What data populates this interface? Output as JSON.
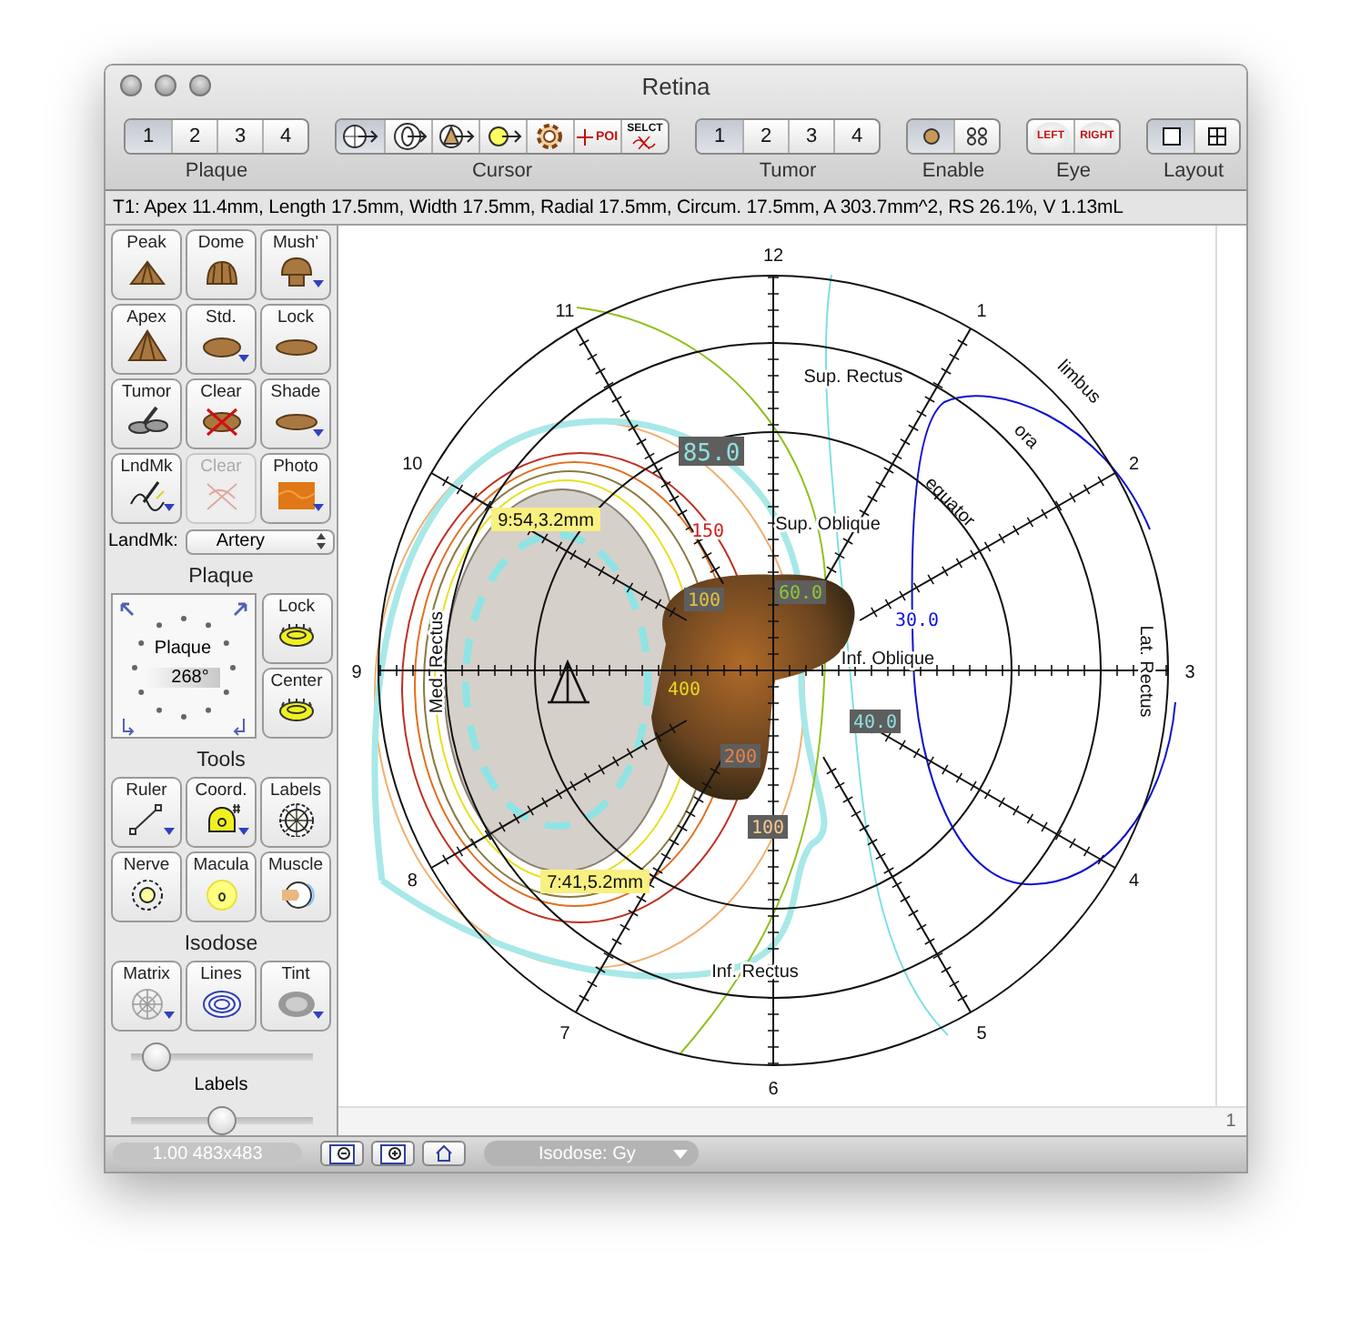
{
  "window": {
    "title": "Retina"
  },
  "toolbar": [
    {
      "label": "Plaque",
      "kind": "numbers",
      "buttons": [
        {
          "text": "1",
          "selected": true
        },
        {
          "text": "2",
          "selected": false
        },
        {
          "text": "3",
          "selected": false
        },
        {
          "text": "4",
          "selected": false
        }
      ]
    },
    {
      "label": "Cursor",
      "kind": "cursor",
      "buttons": [
        {
          "selected": true
        },
        {
          "selected": false
        },
        {
          "selected": false
        },
        {
          "selected": false
        },
        {
          "selected": false
        },
        {
          "text": "POI",
          "selected": false
        },
        {
          "text": "SELCT",
          "selected": false
        }
      ]
    },
    {
      "label": "Tumor",
      "kind": "numbers",
      "buttons": [
        {
          "text": "1",
          "selected": true
        },
        {
          "text": "2",
          "selected": false
        },
        {
          "text": "3",
          "selected": false
        },
        {
          "text": "4",
          "selected": false
        }
      ]
    },
    {
      "label": "Enable",
      "kind": "enable",
      "buttons": [
        {
          "selected": true
        },
        {
          "selected": false
        }
      ]
    },
    {
      "label": "Eye",
      "kind": "eye",
      "buttons": [
        {
          "text": "LEFT",
          "selected": false
        },
        {
          "text": "RIGHT",
          "selected": false
        }
      ]
    },
    {
      "label": "Layout",
      "kind": "layout",
      "buttons": [
        {
          "selected": true
        },
        {
          "selected": false
        }
      ]
    }
  ],
  "info_bar": "T1: Apex 11.4mm, Length 17.5mm, Width 17.5mm, Radial 17.5mm, Circum. 17.5mm, A 303.7mm^2, RS 26.1%, V 1.13mL",
  "sidebar": {
    "shape_tools": [
      {
        "label": "Peak",
        "caret": false,
        "disabled": false
      },
      {
        "label": "Dome",
        "caret": false,
        "disabled": false
      },
      {
        "label": "Mush'",
        "caret": true,
        "disabled": false
      },
      {
        "label": "Apex",
        "caret": false,
        "disabled": false
      },
      {
        "label": "Std.",
        "caret": true,
        "disabled": false
      },
      {
        "label": "Lock",
        "caret": false,
        "disabled": false
      },
      {
        "label": "Tumor",
        "caret": false,
        "disabled": false
      },
      {
        "label": "Clear",
        "caret": false,
        "disabled": false
      },
      {
        "label": "Shade",
        "caret": true,
        "disabled": false
      },
      {
        "label": "LndMk",
        "caret": true,
        "disabled": false
      },
      {
        "label": "Clear",
        "caret": false,
        "disabled": true
      },
      {
        "label": "Photo",
        "caret": true,
        "disabled": false
      }
    ],
    "landmark": {
      "label": "LandMk:",
      "value": "Artery"
    },
    "plaque": {
      "title": "Plaque",
      "dial_label": "Plaque",
      "angle": "268°",
      "buttons": [
        {
          "label": "Lock"
        },
        {
          "label": "Center"
        }
      ]
    },
    "tools": {
      "title": "Tools",
      "buttons": [
        {
          "label": "Ruler",
          "caret": true
        },
        {
          "label": "Coord.",
          "caret": true
        },
        {
          "label": "Labels",
          "caret": false
        },
        {
          "label": "Nerve",
          "caret": false
        },
        {
          "label": "Macula",
          "caret": false
        },
        {
          "label": "Muscle",
          "caret": false
        }
      ]
    },
    "isodose": {
      "title": "Isodose",
      "buttons": [
        {
          "label": "Matrix",
          "caret": true
        },
        {
          "label": "Lines",
          "caret": false
        },
        {
          "label": "Tint",
          "caret": true
        }
      ],
      "slider": {
        "level": 0.08
      },
      "labels_slider": {
        "label": "Labels",
        "level": 0.5
      }
    }
  },
  "diagram": {
    "clock_labels": [
      "12",
      "1",
      "2",
      "3",
      "4",
      "5",
      "6",
      "7",
      "8",
      "9",
      "10",
      "11"
    ],
    "muscle_labels": [
      "Sup. Rectus",
      "Sup. Oblique",
      "Inf. Oblique",
      "Inf. Rectus",
      "Lat. Rectus",
      "Med. Rectus"
    ],
    "ring_labels": [
      "limbus",
      "ora",
      "equator"
    ],
    "dose_labels": [
      {
        "text": "85.0",
        "color": "#8ee0e0",
        "boxed": true
      },
      {
        "text": "150",
        "color": "#d02020",
        "boxed": false
      },
      {
        "text": "100",
        "color": "#e8c040",
        "boxed": true
      },
      {
        "text": "400",
        "color": "#e8d820",
        "boxed": false
      },
      {
        "text": "200",
        "color": "#f08040",
        "boxed": true
      },
      {
        "text": "100",
        "color": "#f8c890",
        "boxed": true
      },
      {
        "text": "60.0",
        "color": "#90c830",
        "boxed": true
      },
      {
        "text": "30.0",
        "color": "#1010e0",
        "boxed": false
      },
      {
        "text": "40.0",
        "color": "#90e0e0",
        "boxed": true
      }
    ],
    "markers": [
      "9:54,3.2mm",
      "7:41,5.2mm"
    ]
  },
  "scroll_corner": "1",
  "status_bar": {
    "zoom": "1.00 483x483",
    "isodose_menu": "Isodose: Gy"
  }
}
